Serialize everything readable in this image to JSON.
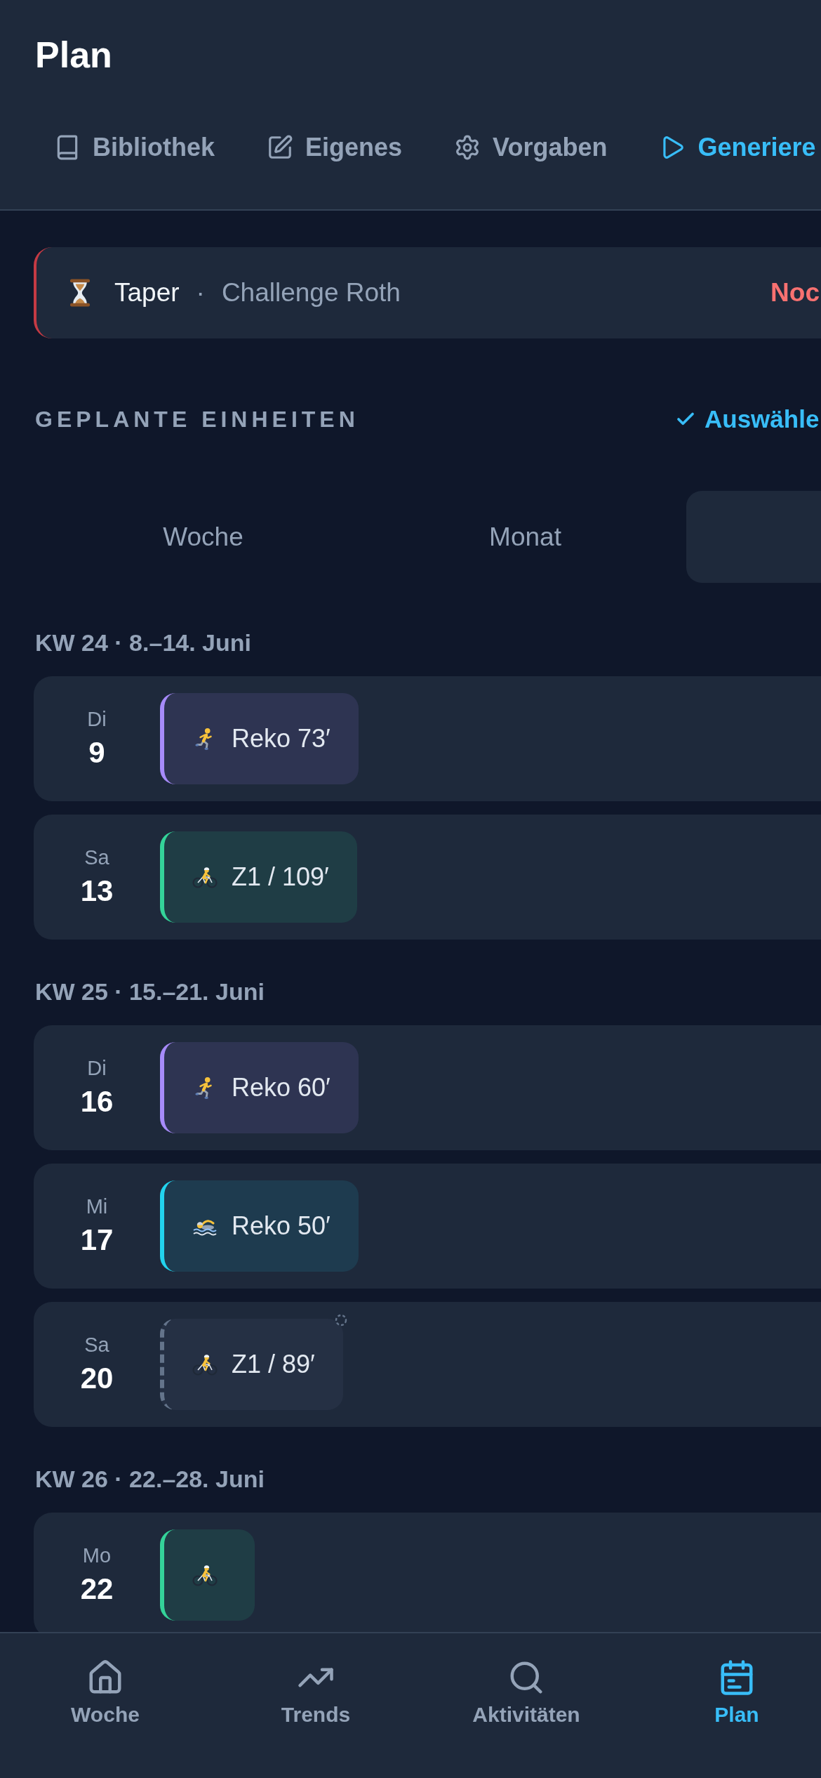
{
  "header": {
    "title": "Plan",
    "tabs": [
      {
        "kind": "library",
        "label": "Bibliothek",
        "selected": false
      },
      {
        "kind": "edit",
        "label": "Eigenes",
        "selected": false
      },
      {
        "kind": "settings",
        "label": "Vorgaben",
        "selected": false
      },
      {
        "kind": "generate",
        "label": "Generiere",
        "selected": true
      }
    ]
  },
  "phase_banner": {
    "phase": "Taper",
    "separator": "·",
    "race": "Challenge Roth",
    "note": "Noc"
  },
  "section": {
    "title": "GEPLANTE EINHEITEN",
    "action": "Auswähle"
  },
  "view_switch": [
    {
      "label": "Woche",
      "selected": false
    },
    {
      "label": "Monat",
      "selected": false
    },
    {
      "selected": true
    }
  ],
  "weeks": [
    {
      "title": "KW 24 · 8.–14. Juni",
      "days": [
        {
          "weekday": "Di",
          "date": "9",
          "sessions": [
            {
              "kind": "run",
              "label": "Reko 73′",
              "pending": false
            }
          ]
        },
        {
          "weekday": "Sa",
          "date": "13",
          "sessions": [
            {
              "kind": "bike",
              "label": "Z1 / 109′",
              "pending": false
            }
          ]
        }
      ]
    },
    {
      "title": "KW 25 · 15.–21. Juni",
      "days": [
        {
          "weekday": "Di",
          "date": "16",
          "sessions": [
            {
              "kind": "run",
              "label": "Reko 60′",
              "pending": false
            }
          ]
        },
        {
          "weekday": "Mi",
          "date": "17",
          "sessions": [
            {
              "kind": "swim",
              "label": "Reko 50′",
              "pending": false
            }
          ]
        },
        {
          "weekday": "Sa",
          "date": "20",
          "sessions": [
            {
              "kind": "bike",
              "label": "Z1 / 89′",
              "pending": true
            }
          ]
        }
      ]
    },
    {
      "title": "KW 26 · 22.–28. Juni",
      "days": [
        {
          "weekday": "Mo",
          "date": "22",
          "sessions": [
            {
              "kind": "bike",
              "pending": false
            }
          ]
        }
      ]
    }
  ],
  "bottom_nav": [
    {
      "kind": "home",
      "label": "Woche",
      "selected": false
    },
    {
      "kind": "trends",
      "label": "Trends",
      "selected": false
    },
    {
      "kind": "search",
      "label": "Aktivitäten",
      "selected": false
    },
    {
      "kind": "plan",
      "label": "Plan",
      "selected": true
    }
  ]
}
